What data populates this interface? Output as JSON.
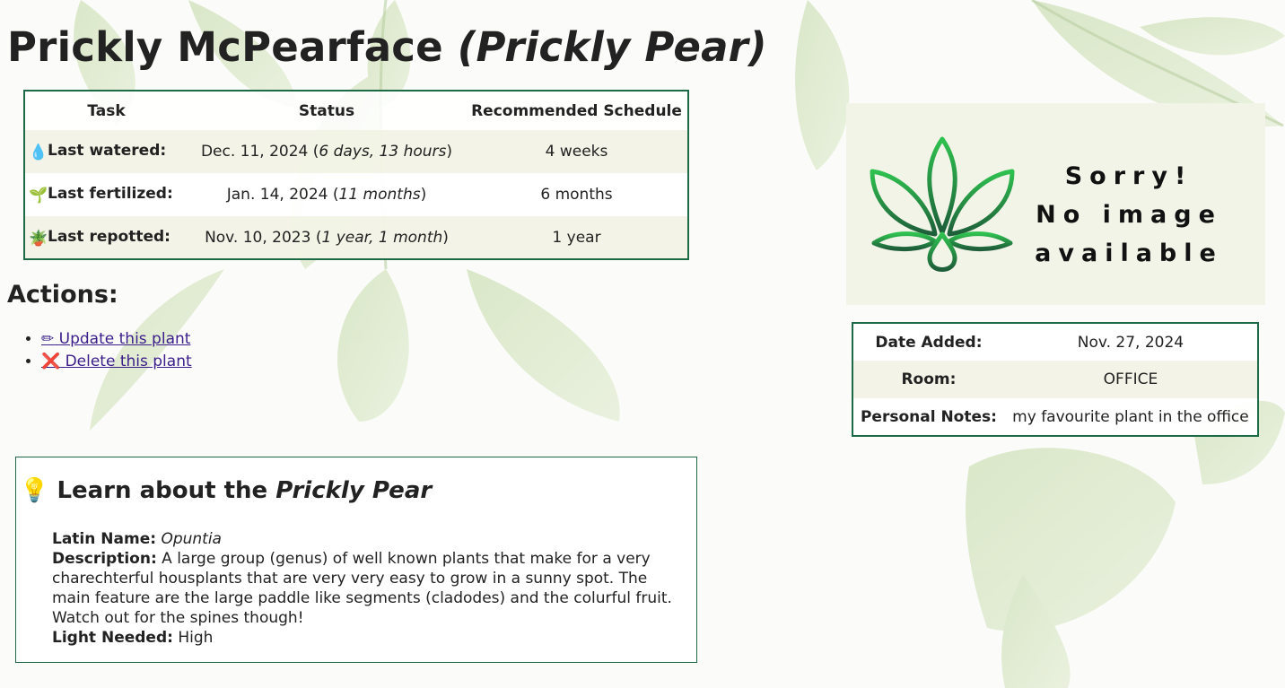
{
  "page": {
    "plant_name": "Prickly McPearface",
    "species_display": "(Prickly Pear)"
  },
  "care_table": {
    "headers": [
      "Task",
      "Status",
      "Recommended Schedule"
    ],
    "rows": [
      {
        "icon": "water-drop-icon",
        "glyph": "💧",
        "label": "Last watered:",
        "date": "Dec. 11, 2024",
        "ago": "6 days, 13 hours",
        "schedule": "4 weeks"
      },
      {
        "icon": "seedling-icon",
        "glyph": "🌱",
        "label": "Last fertilized:",
        "date": "Jan. 14, 2024",
        "ago": "11 months",
        "schedule": "6 months"
      },
      {
        "icon": "potted-plant-icon",
        "glyph": "🪴",
        "label": "Last repotted:",
        "date": "Nov. 10, 2023",
        "ago": "1 year, 1 month",
        "schedule": "1 year"
      }
    ]
  },
  "actions": {
    "heading": "Actions:",
    "items": [
      {
        "icon": "pencil-icon",
        "glyph": "✏",
        "label": "Update this plant"
      },
      {
        "icon": "red-x-icon",
        "glyph": "❌",
        "label": "Delete this plant"
      }
    ]
  },
  "learn": {
    "icon": "lightbulb-icon",
    "glyph": "💡",
    "heading_prefix": "Learn about the",
    "heading_species": "Prickly Pear",
    "latin_label": "Latin Name:",
    "latin_value": "Opuntia",
    "description_label": "Description:",
    "description_value": "A large group (genus) of well known plants that make for a very charechterful housplants that are very very easy to grow in a sunny spot. The main feature are the large paddle like segments (cladodes) and the colurful fruit. Watch out for the spines though!",
    "light_label": "Light Needed:",
    "light_value": "High"
  },
  "no_image": {
    "logo_icon": "plant-logo-icon",
    "line1": "Sorry!",
    "line2": "No image",
    "line3": "available"
  },
  "info_table": {
    "rows": [
      {
        "label": "Date Added:",
        "value": "Nov. 27, 2024"
      },
      {
        "label": "Room:",
        "value": "OFFICE"
      },
      {
        "label": "Personal Notes:",
        "value": "my favourite plant in the office"
      }
    ]
  },
  "colors": {
    "border_green": "#1d6b46",
    "link": "#3a1d8a",
    "row_tint": "#f3f4e6",
    "logo_green": "#2fb34a"
  }
}
